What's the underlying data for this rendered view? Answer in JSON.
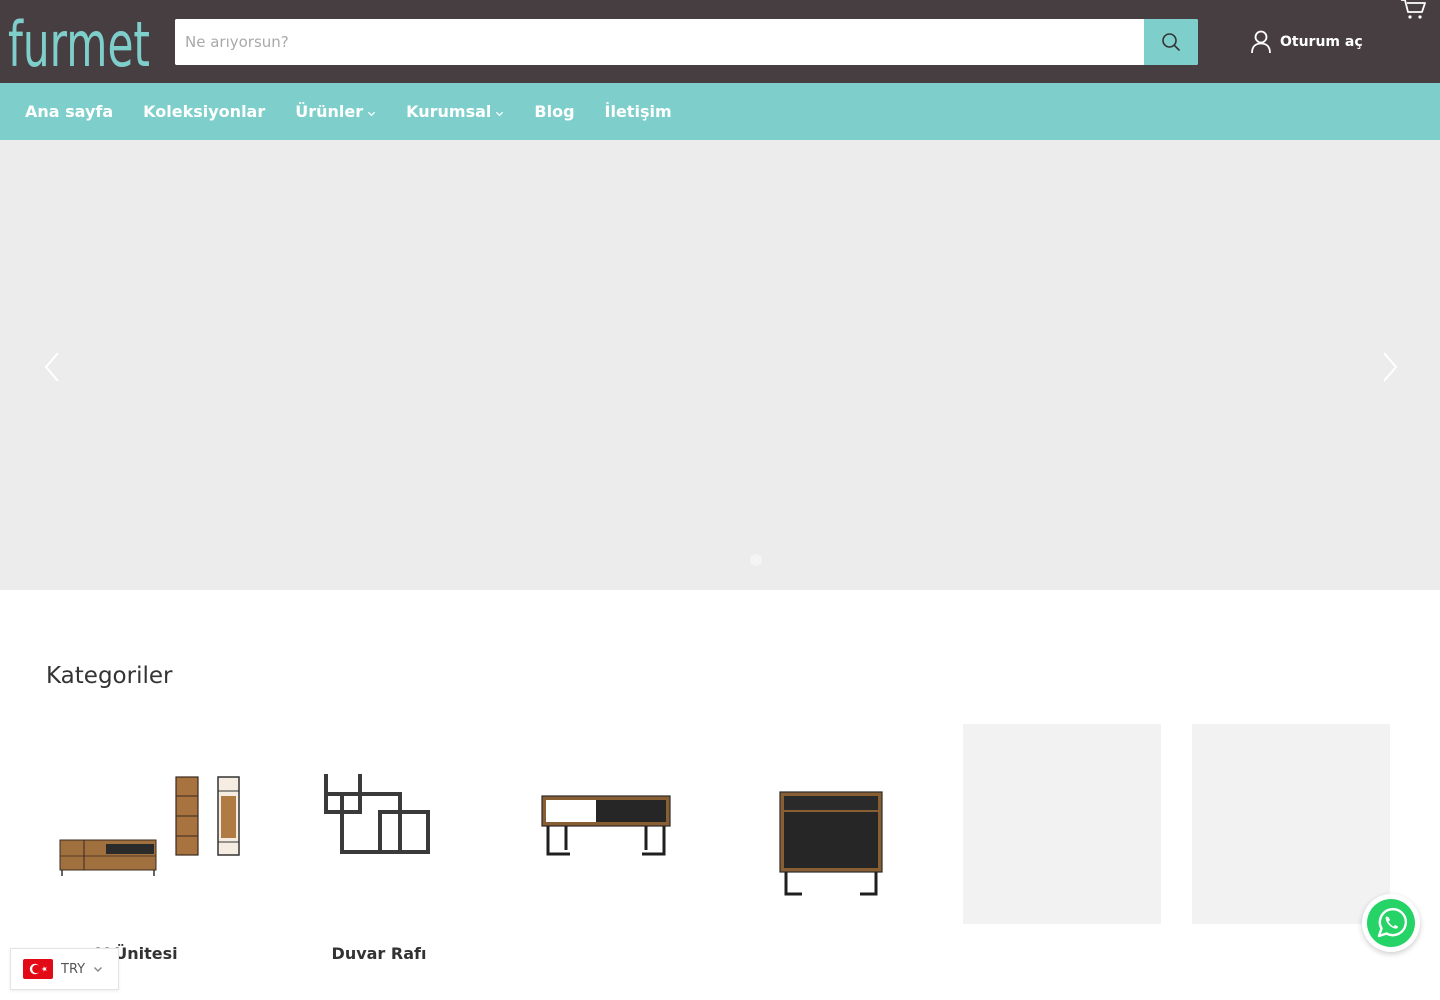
{
  "brand": {
    "logo_text": "furmet",
    "logo_color": "#7ecfcb",
    "header_bg": "#473e41"
  },
  "search": {
    "placeholder": "Ne arıyorsun?",
    "value": "",
    "icon": "search-icon",
    "button_color": "#7ecfcb"
  },
  "account": {
    "login_label": "Oturum aç",
    "icon": "user-icon"
  },
  "cart": {
    "icon": "cart-icon"
  },
  "nav": {
    "bg": "#7ecfcb",
    "items": [
      {
        "label": "Ana sayfa",
        "has_dropdown": false
      },
      {
        "label": "Koleksiyonlar",
        "has_dropdown": false
      },
      {
        "label": "Ürünler",
        "has_dropdown": true
      },
      {
        "label": "Kurumsal",
        "has_dropdown": true
      },
      {
        "label": "Blog",
        "has_dropdown": false
      },
      {
        "label": "İletişim",
        "has_dropdown": false
      }
    ]
  },
  "hero": {
    "prev_icon": "chevron-left-icon",
    "next_icon": "chevron-right-icon",
    "slide_count": 1
  },
  "categories": {
    "title": "Kategoriler",
    "items": [
      {
        "label": "V Ünitesi",
        "image": "tv-unit-with-shelves"
      },
      {
        "label": "Duvar Rafı",
        "image": "wall-shelf"
      },
      {
        "label": "",
        "image": "coffee-table"
      },
      {
        "label": "",
        "image": "side-cabinet"
      },
      {
        "label": "",
        "image": ""
      },
      {
        "label": "",
        "image": ""
      }
    ]
  },
  "currency": {
    "code": "TRY",
    "flag": "turkey-flag-icon"
  },
  "whatsapp": {
    "icon": "whatsapp-icon",
    "color": "#25d366"
  }
}
